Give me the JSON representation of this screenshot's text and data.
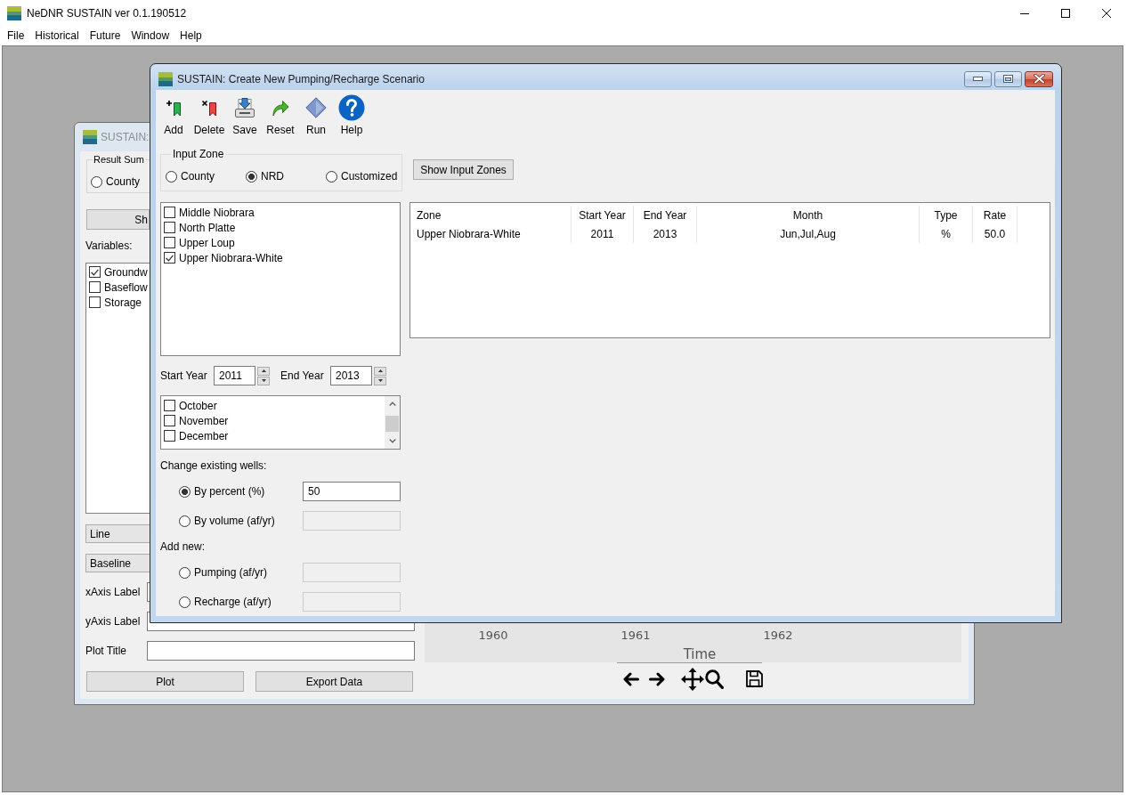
{
  "app_window": {
    "title": "NeDNR SUSTAIN ver 0.1.190512",
    "menu": [
      "File",
      "Historical",
      "Future",
      "Window",
      "Help"
    ]
  },
  "results_window": {
    "title": "SUSTAIN:",
    "result_summary": {
      "legend": "Result Sum",
      "options": [
        {
          "label": "County",
          "selected": false
        }
      ]
    },
    "show_button": "Sh",
    "variables_label": "Variables:",
    "variables": [
      {
        "label": "Groundw",
        "checked": true
      },
      {
        "label": "Baseflow",
        "checked": false
      },
      {
        "label": "Storage",
        "checked": false
      }
    ],
    "plot_type": "Line",
    "scenario": "Baseline",
    "fields": [
      {
        "label": "xAxis Label"
      },
      {
        "label": "yAxis Label"
      },
      {
        "label": "Plot Title"
      }
    ],
    "buttons": [
      "Plot",
      "Export Data"
    ],
    "plot": {
      "x_ticks": [
        "1960",
        "1961",
        "1962"
      ],
      "x_label": "Time"
    }
  },
  "scenario_dialog": {
    "title": "SUSTAIN: Create New Pumping/Recharge Scenario",
    "toolbar": [
      {
        "label": "Add",
        "kind": "add"
      },
      {
        "label": "Delete",
        "kind": "delete"
      },
      {
        "label": "Save",
        "kind": "save"
      },
      {
        "label": "Reset",
        "kind": "reset"
      },
      {
        "label": "Run",
        "kind": "run"
      },
      {
        "label": "Help",
        "kind": "help"
      }
    ],
    "input_zone": {
      "legend": "Input Zone",
      "options": [
        {
          "label": "County",
          "selected": false
        },
        {
          "label": "NRD",
          "selected": true
        },
        {
          "label": "Customized",
          "selected": false
        }
      ]
    },
    "show_zones_button": "Show Input Zones",
    "zones": [
      {
        "label": "Middle Niobrara",
        "checked": false
      },
      {
        "label": "North Platte",
        "checked": false
      },
      {
        "label": "Upper Loup",
        "checked": false
      },
      {
        "label": "Upper Niobrara-White",
        "checked": true
      }
    ],
    "start_year": {
      "label": "Start Year",
      "value": "2011"
    },
    "end_year": {
      "label": "End Year",
      "value": "2013"
    },
    "months": [
      {
        "label": "October",
        "checked": false
      },
      {
        "label": "November",
        "checked": false
      },
      {
        "label": "December",
        "checked": false
      }
    ],
    "change_wells": {
      "label": "Change existing wells:",
      "options": [
        {
          "label": "By percent (%)",
          "selected": true,
          "disabled": false,
          "value": "50"
        },
        {
          "label": "By volume (af/yr)",
          "selected": false,
          "disabled": true
        }
      ]
    },
    "add_new": {
      "label": "Add new:",
      "options": [
        {
          "label": "Pumping (af/yr)",
          "selected": false,
          "disabled": true
        },
        {
          "label": "Recharge (af/yr)",
          "selected": false,
          "disabled": true
        }
      ]
    },
    "table": {
      "columns": [
        "Zone",
        "Start Year",
        "End Year",
        "Month",
        "Type",
        "Rate"
      ],
      "rows": [
        [
          "Upper Niobrara-White",
          "2011",
          "2013",
          "Jun,Jul,Aug",
          "%",
          "50.0"
        ]
      ]
    }
  }
}
